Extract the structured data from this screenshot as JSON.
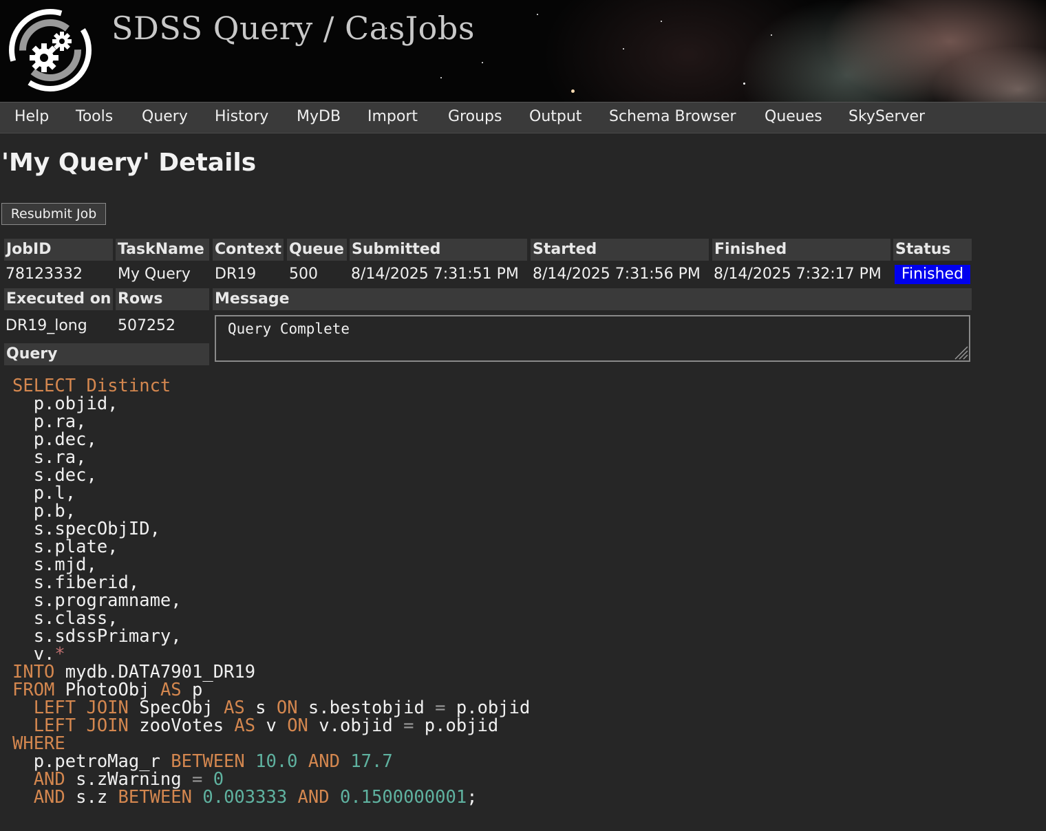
{
  "header": {
    "title": "SDSS Query / CasJobs"
  },
  "nav": [
    {
      "label": "Help"
    },
    {
      "label": "Tools"
    },
    {
      "label": "Query"
    },
    {
      "label": "History"
    },
    {
      "label": "MyDB"
    },
    {
      "label": "Import"
    },
    {
      "label": "Groups"
    },
    {
      "label": "Output"
    },
    {
      "label": "Schema Browser"
    },
    {
      "label": "Queues"
    },
    {
      "label": "SkyServer"
    }
  ],
  "page": {
    "title": "'My Query' Details",
    "resubmit_label": "Resubmit Job"
  },
  "job": {
    "headers": {
      "jobid": "JobID",
      "taskname": "TaskName",
      "context": "Context",
      "queue": "Queue",
      "submitted": "Submitted",
      "started": "Started",
      "finished": "Finished",
      "status": "Status",
      "executed_on": "Executed on",
      "rows": "Rows",
      "message": "Message",
      "query": "Query"
    },
    "values": {
      "jobid": "78123332",
      "taskname": "My Query",
      "context": "DR19",
      "queue": "500",
      "submitted": "8/14/2025 7:31:51 PM",
      "started": "8/14/2025 7:31:56 PM",
      "finished": "8/14/2025 7:32:17 PM",
      "status": "Finished",
      "executed_on": "DR19_long",
      "rows": "507252",
      "message": "Query Complete"
    },
    "status_color": "#0000ee"
  },
  "query_lines": [
    [
      {
        "t": "SELECT Distinct",
        "c": "kw"
      }
    ],
    [
      {
        "t": "  p.objid,",
        "c": ""
      }
    ],
    [
      {
        "t": "  p.ra,",
        "c": ""
      }
    ],
    [
      {
        "t": "  p.dec,",
        "c": ""
      }
    ],
    [
      {
        "t": "  s.ra,",
        "c": ""
      }
    ],
    [
      {
        "t": "  s.dec,",
        "c": ""
      }
    ],
    [
      {
        "t": "  p.l,",
        "c": ""
      }
    ],
    [
      {
        "t": "  p.b,",
        "c": ""
      }
    ],
    [
      {
        "t": "  s.specObjID,",
        "c": ""
      }
    ],
    [
      {
        "t": "  s.plate,",
        "c": ""
      }
    ],
    [
      {
        "t": "  s.mjd,",
        "c": ""
      }
    ],
    [
      {
        "t": "  s.fiberid,",
        "c": ""
      }
    ],
    [
      {
        "t": "  s.programname,",
        "c": ""
      }
    ],
    [
      {
        "t": "  s.class,",
        "c": ""
      }
    ],
    [
      {
        "t": "  s.sdssPrimary,",
        "c": ""
      }
    ],
    [
      {
        "t": "  v.",
        "c": ""
      },
      {
        "t": "*",
        "c": "star-op"
      }
    ],
    [
      {
        "t": "INTO",
        "c": "kw"
      },
      {
        "t": " mydb.DATA7901_DR19",
        "c": ""
      }
    ],
    [
      {
        "t": "FROM",
        "c": "kw"
      },
      {
        "t": " PhotoObj ",
        "c": ""
      },
      {
        "t": "AS",
        "c": "kw"
      },
      {
        "t": " p",
        "c": ""
      }
    ],
    [
      {
        "t": "  LEFT JOIN",
        "c": "kw"
      },
      {
        "t": " SpecObj ",
        "c": ""
      },
      {
        "t": "AS",
        "c": "kw"
      },
      {
        "t": " s ",
        "c": ""
      },
      {
        "t": "ON",
        "c": "kw"
      },
      {
        "t": " s.bestobjid ",
        "c": ""
      },
      {
        "t": "=",
        "c": "op"
      },
      {
        "t": " p.objid",
        "c": ""
      }
    ],
    [
      {
        "t": "  LEFT JOIN",
        "c": "kw"
      },
      {
        "t": " zooVotes ",
        "c": ""
      },
      {
        "t": "AS",
        "c": "kw"
      },
      {
        "t": " v ",
        "c": ""
      },
      {
        "t": "ON",
        "c": "kw"
      },
      {
        "t": " v.objid ",
        "c": ""
      },
      {
        "t": "=",
        "c": "op"
      },
      {
        "t": " p.objid",
        "c": ""
      }
    ],
    [
      {
        "t": "WHERE",
        "c": "kw"
      }
    ],
    [
      {
        "t": "  p.petroMag_r ",
        "c": ""
      },
      {
        "t": "BETWEEN",
        "c": "kw"
      },
      {
        "t": " ",
        "c": ""
      },
      {
        "t": "10.0",
        "c": "num"
      },
      {
        "t": " ",
        "c": ""
      },
      {
        "t": "AND",
        "c": "kw"
      },
      {
        "t": " ",
        "c": ""
      },
      {
        "t": "17.7",
        "c": "num"
      }
    ],
    [
      {
        "t": "  AND",
        "c": "kw"
      },
      {
        "t": " s.zWarning ",
        "c": ""
      },
      {
        "t": "=",
        "c": "op"
      },
      {
        "t": " ",
        "c": ""
      },
      {
        "t": "0",
        "c": "num"
      }
    ],
    [
      {
        "t": "  AND",
        "c": "kw"
      },
      {
        "t": " s.z ",
        "c": ""
      },
      {
        "t": "BETWEEN",
        "c": "kw"
      },
      {
        "t": " ",
        "c": ""
      },
      {
        "t": "0.003333",
        "c": "num"
      },
      {
        "t": " ",
        "c": ""
      },
      {
        "t": "AND",
        "c": "kw"
      },
      {
        "t": " ",
        "c": ""
      },
      {
        "t": "0.1500000001",
        "c": "num"
      },
      {
        "t": ";",
        "c": ""
      }
    ]
  ]
}
